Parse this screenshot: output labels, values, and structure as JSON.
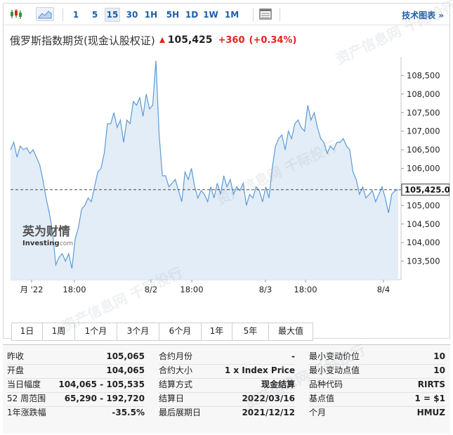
{
  "toolbar": {
    "intervals": [
      "1",
      "5",
      "15",
      "30",
      "1H",
      "5H",
      "1D",
      "1W",
      "1M"
    ],
    "active_interval": "15",
    "tech_chart_label": "技术图表 »"
  },
  "header": {
    "title": "俄罗斯指数期货(现金认股权证)",
    "price": "105,425",
    "change": "+360",
    "change_pct": "(+0.34%)"
  },
  "colors": {
    "up": "#e0251b",
    "link": "#1d5ea8",
    "line": "#5b9bd5",
    "area": "#e3edf7"
  },
  "logo": {
    "cn": "英为财情",
    "en": "Investing",
    "en_suffix": ".com"
  },
  "chart_data": {
    "type": "area",
    "ylim": [
      103000,
      109000
    ],
    "yticks": [
      "108,500",
      "108,000",
      "107,500",
      "107,000",
      "106,500",
      "106,000",
      "105,500",
      "105,000",
      "104,500",
      "104,000",
      "103,500"
    ],
    "ytick_values": [
      108500,
      108000,
      107500,
      107000,
      106500,
      106000,
      105500,
      105000,
      104500,
      104000,
      103500
    ],
    "xticks": [
      "月 '22",
      "18:00",
      "8/2",
      "18:00",
      "8/3",
      "18:00",
      "8/4"
    ],
    "last_label": "105,425.0",
    "last_value": 105425,
    "values": [
      106500,
      106700,
      106300,
      106600,
      106500,
      106550,
      106400,
      106500,
      106300,
      106100,
      105700,
      105200,
      104800,
      104300,
      103400,
      103600,
      103700,
      103500,
      103700,
      103300,
      104100,
      104400,
      104900,
      105000,
      105200,
      105100,
      105500,
      105900,
      106000,
      106400,
      107200,
      107200,
      107500,
      107100,
      107300,
      106700,
      107300,
      107200,
      107800,
      107700,
      107900,
      107400,
      108000,
      107600,
      107700,
      108900,
      106900,
      105800,
      105800,
      105500,
      105600,
      105700,
      105400,
      105100,
      105900,
      105700,
      106000,
      105500,
      105200,
      105400,
      105300,
      105100,
      105500,
      105200,
      105600,
      105300,
      105800,
      105500,
      105700,
      105300,
      105500,
      105400,
      105600,
      105000,
      105300,
      105200,
      105500,
      105400,
      105100,
      105500,
      105200,
      106000,
      106600,
      106800,
      106900,
      106500,
      107000,
      106800,
      107200,
      107300,
      107100,
      107000,
      107700,
      107300,
      107500,
      107100,
      106800,
      106700,
      106400,
      106600,
      106500,
      106700,
      106700,
      106800,
      106600,
      106500,
      105900,
      105700,
      105300,
      105500,
      105200,
      105300,
      105400,
      105100,
      105300,
      105500,
      105200,
      104800,
      105300,
      105400,
      105425
    ]
  },
  "ranges": [
    "1日",
    "1周",
    "1个月",
    "3个月",
    "6个月",
    "1年",
    "5年",
    "最大值"
  ],
  "stats": {
    "col1": [
      {
        "k": "昨收",
        "v": "105,065"
      },
      {
        "k": "开盘",
        "v": "104,065"
      },
      {
        "k": "当日幅度",
        "v": "104,065 - 105,535"
      },
      {
        "k": "52 周范围",
        "v": "65,290 - 192,720"
      },
      {
        "k": "1年涨跌幅",
        "v": "-35.5%"
      }
    ],
    "col2": [
      {
        "k": "合约月份",
        "v": "-"
      },
      {
        "k": "合约大小",
        "v": "1 x Index Price"
      },
      {
        "k": "结算方式",
        "v": "现金结算"
      },
      {
        "k": "结算日",
        "v": "2022/03/16"
      },
      {
        "k": "最后展期日",
        "v": "2021/12/12"
      }
    ],
    "col3": [
      {
        "k": "最小变动价位",
        "v": "10"
      },
      {
        "k": "最小变动点值",
        "v": "10"
      },
      {
        "k": "品种代码",
        "v": "RIRTS"
      },
      {
        "k": "基点值",
        "v": "1 = $1"
      },
      {
        "k": "个月",
        "v": "HMUZ"
      }
    ]
  }
}
